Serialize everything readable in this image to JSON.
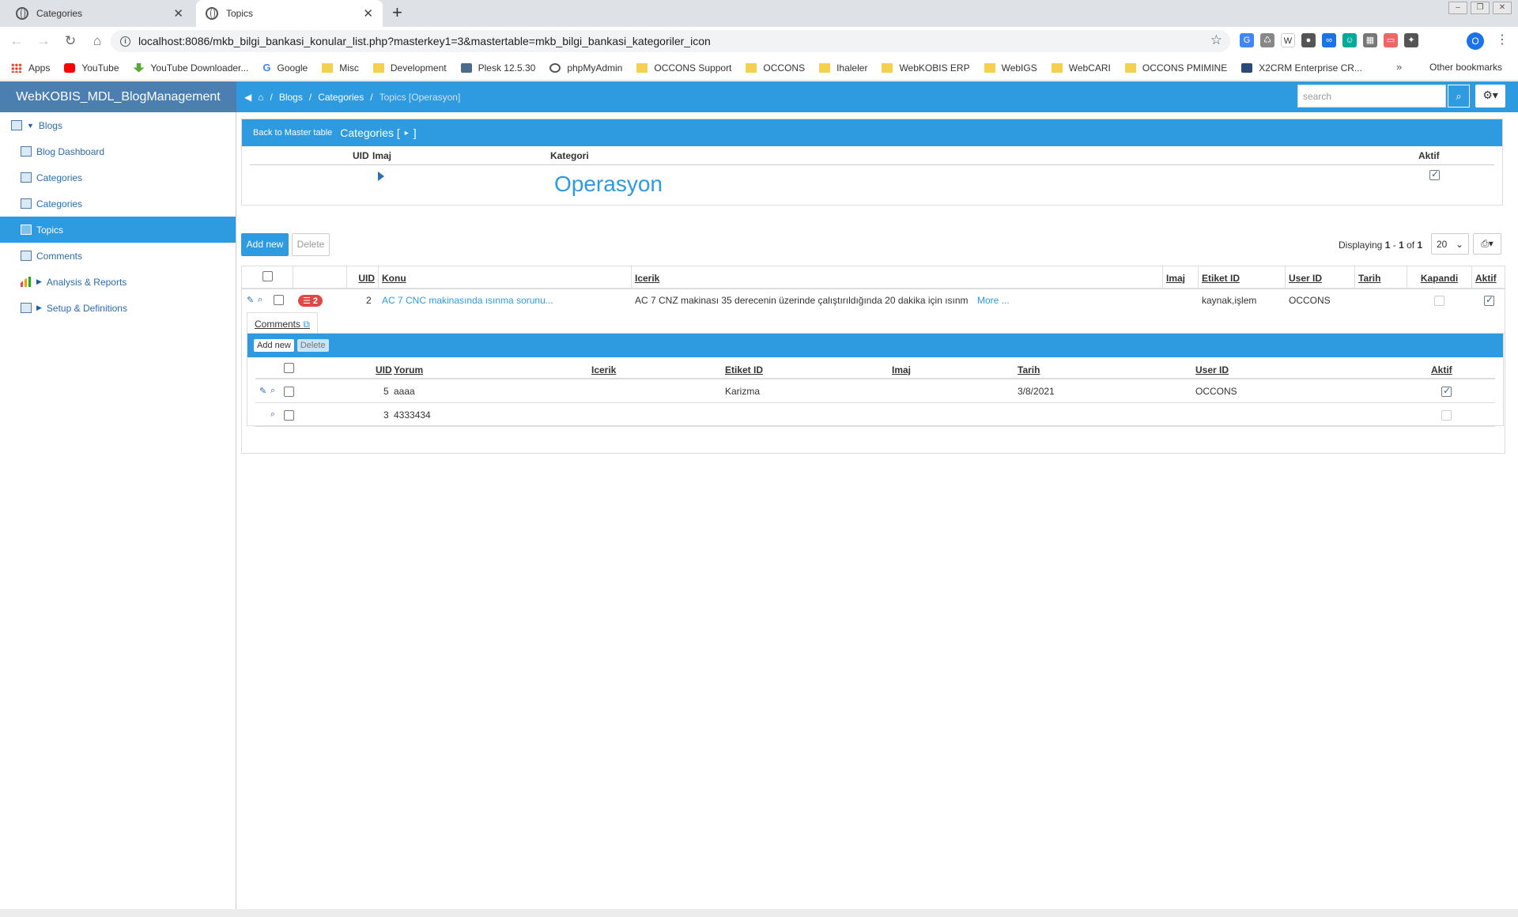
{
  "browser": {
    "tabs": [
      {
        "title": "Categories",
        "active": false
      },
      {
        "title": "Topics",
        "active": true
      }
    ],
    "url": "localhost:8086/mkb_bilgi_bankasi_konular_list.php?masterkey1=3&mastertable=mkb_bilgi_bankasi_kategoriler_icon",
    "profile_initial": "O",
    "bookmarks": [
      {
        "label": "Apps",
        "icon": "apps"
      },
      {
        "label": "YouTube",
        "icon": "youtube"
      },
      {
        "label": "YouTube Downloader...",
        "icon": "download"
      },
      {
        "label": "Google",
        "icon": "google"
      },
      {
        "label": "Misc",
        "icon": "folder"
      },
      {
        "label": "Development",
        "icon": "folder"
      },
      {
        "label": "Plesk 12.5.30",
        "icon": "plesk"
      },
      {
        "label": "phpMyAdmin",
        "icon": "globe"
      },
      {
        "label": "OCCONS Support",
        "icon": "folder"
      },
      {
        "label": "OCCONS",
        "icon": "folder"
      },
      {
        "label": "Ihaleler",
        "icon": "folder"
      },
      {
        "label": "WebKOBIS ERP",
        "icon": "folder"
      },
      {
        "label": "WebIGS",
        "icon": "folder"
      },
      {
        "label": "WebCARI",
        "icon": "folder"
      },
      {
        "label": "OCCONS PMIMINE",
        "icon": "folder"
      },
      {
        "label": "X2CRM Enterprise CR...",
        "icon": "x2"
      }
    ],
    "more_bookmarks": "»",
    "other_bookmarks": "Other bookmarks"
  },
  "app": {
    "brand": "WebKOBIS_MDL_BlogManagement",
    "sidebar": [
      {
        "label": "Blogs",
        "level": "top",
        "expanded": true
      },
      {
        "label": "Blog Dashboard"
      },
      {
        "label": "Categories"
      },
      {
        "label": "Categories"
      },
      {
        "label": "Topics",
        "active": true
      },
      {
        "label": "Comments"
      },
      {
        "label": "Analysis & Reports",
        "level": "sub-group"
      },
      {
        "label": "Setup & Definitions",
        "level": "sub-group"
      }
    ],
    "breadcrumb": {
      "items": [
        "Blogs",
        "Categories"
      ],
      "separator": "/",
      "current": "Topics [Operasyon]"
    },
    "search_placeholder": "search",
    "master": {
      "back_label": "Back to Master table",
      "title": "Categories [",
      "title_end": "]",
      "columns": [
        "UID",
        "Imaj",
        "Kategori",
        "Aktif"
      ],
      "row": {
        "kategori": "Operasyon",
        "aktif": true
      }
    },
    "toolbar": {
      "add_label": "Add new",
      "delete_label": "Delete",
      "displaying_prefix": "Displaying ",
      "range_start": "1",
      "range_sep": " - ",
      "range_end": "1",
      "of": " of ",
      "total": "1",
      "page_size": "20"
    },
    "topics": {
      "columns": [
        "UID",
        "Konu",
        "Icerik",
        "Imaj",
        "Etiket ID",
        "User ID",
        "Tarih",
        "Kapandi",
        "Aktif"
      ],
      "rows": [
        {
          "comment_count": "2",
          "uid": "2",
          "konu": "AC 7 CNC makinasında ısınma sorunu...",
          "icerik": "AC 7 CNZ makinası 35 derecenin üzerinde çalıştırıldığında 20 dakika için ısınm",
          "more": "More ...",
          "etiket": "kaynak,işlem",
          "user": "OCCONS",
          "kapandi": false,
          "aktif": true
        }
      ]
    },
    "comments": {
      "tab_label": "Comments",
      "add_label": "Add new",
      "delete_label": "Delete",
      "columns": [
        "UID",
        "Yorum",
        "Icerik",
        "Etiket ID",
        "Imaj",
        "Tarih",
        "User ID",
        "Aktif"
      ],
      "rows": [
        {
          "uid": "5",
          "yorum": "aaaa",
          "etiket": "Karizma",
          "tarih": "3/8/2021",
          "user": "OCCONS",
          "aktif": true,
          "editable": true
        },
        {
          "uid": "3",
          "yorum": "4333434",
          "etiket": "",
          "tarih": "",
          "user": "",
          "aktif": false,
          "editable": false
        }
      ]
    }
  }
}
